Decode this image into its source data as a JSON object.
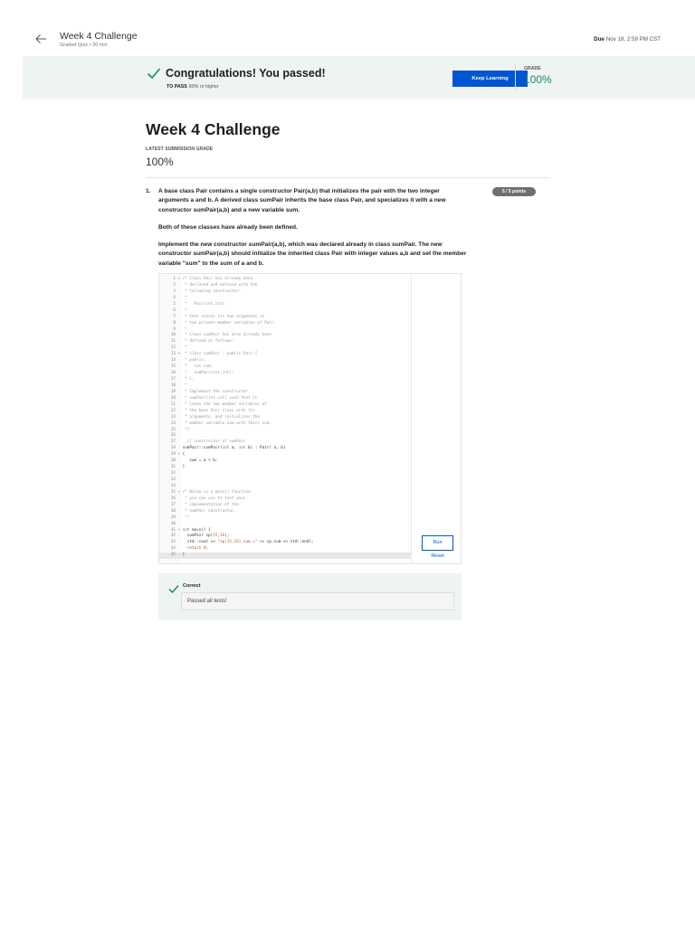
{
  "header": {
    "title": "Week 4 Challenge",
    "subtitle": "Graded Quiz • 30 min",
    "due_label": "Due",
    "due_value": "Nov 18, 2:59 PM CST"
  },
  "banner": {
    "title": "Congratulations! You passed!",
    "to_pass_label": "TO PASS",
    "to_pass_value": "80% or higher",
    "keep_learning": "Keep Learning",
    "grade_label": "GRADE",
    "grade_value": "100%"
  },
  "main": {
    "title": "Week 4 Challenge",
    "latest_label": "LATEST SUBMISSION GRADE",
    "latest_value": "100%"
  },
  "question": {
    "number": "1.",
    "points": "5 / 5 points",
    "paragraphs": [
      "A base class Pair contains a single constructor Pair(a,b) that initializes the pair with the two integer arguments a and b. A derived class sumPair inherits the base class Pair, and specializes it with a new constructor sumPair(a,b) and a new variable sum.",
      "Both of these classes have already been defined.",
      "Implement the new constructor sumPair(a,b), which was declared already in class sumPair. The new constructor sumPair(a,b) should initialize the inherited class Pair with integer values a,b and set the member variable \"sum\" to the sum of a and b."
    ]
  },
  "editor": {
    "run_label": "Run",
    "reset_label": "Reset",
    "lines": [
      "/* Class Pair has already been",
      " * declared and defined with the",
      " * following constructor:",
      " *",
      " *   Pair(int,int)",
      " *",
      " * that stores its two arguments in",
      " * two private member variables of Pair.",
      " *",
      " * Class sumPair has also already been",
      " * defined as follows:",
      " *",
      " * class sumPair : public Pair {",
      " * public:",
      " *   int sum;",
      " *   sumPair(int,int);",
      " * };",
      " *",
      " * Implement the constructor",
      " * sumPair(int,int) such that it",
      " * loads the two member variables of",
      " * the base Pair class with its",
      " * arguments, and initializes the",
      " * member variable sum with their sum.",
      " */",
      "",
      "  // constructor of sumPair",
      "sumPair::sumPair(int a, int b) : Pair( a, b)",
      "{",
      "   sum = a + b;",
      "}",
      "",
      "",
      "",
      "/* Below is a main() function",
      " * you can use to test your",
      " * implementation of the",
      " * sumPair constructor.",
      " */",
      "",
      "int main() {",
      "  sumPair sp(15,16);",
      "  std::cout << \"sp(15,16).sum =\" << sp.sum << std::endl;",
      "  return 0;",
      "}"
    ]
  },
  "result": {
    "title": "Correct",
    "message": "Passed all tests!"
  },
  "colors": {
    "accent": "#0056d2",
    "success": "#1b8a5a",
    "banner_bg": "#eef4f1"
  }
}
